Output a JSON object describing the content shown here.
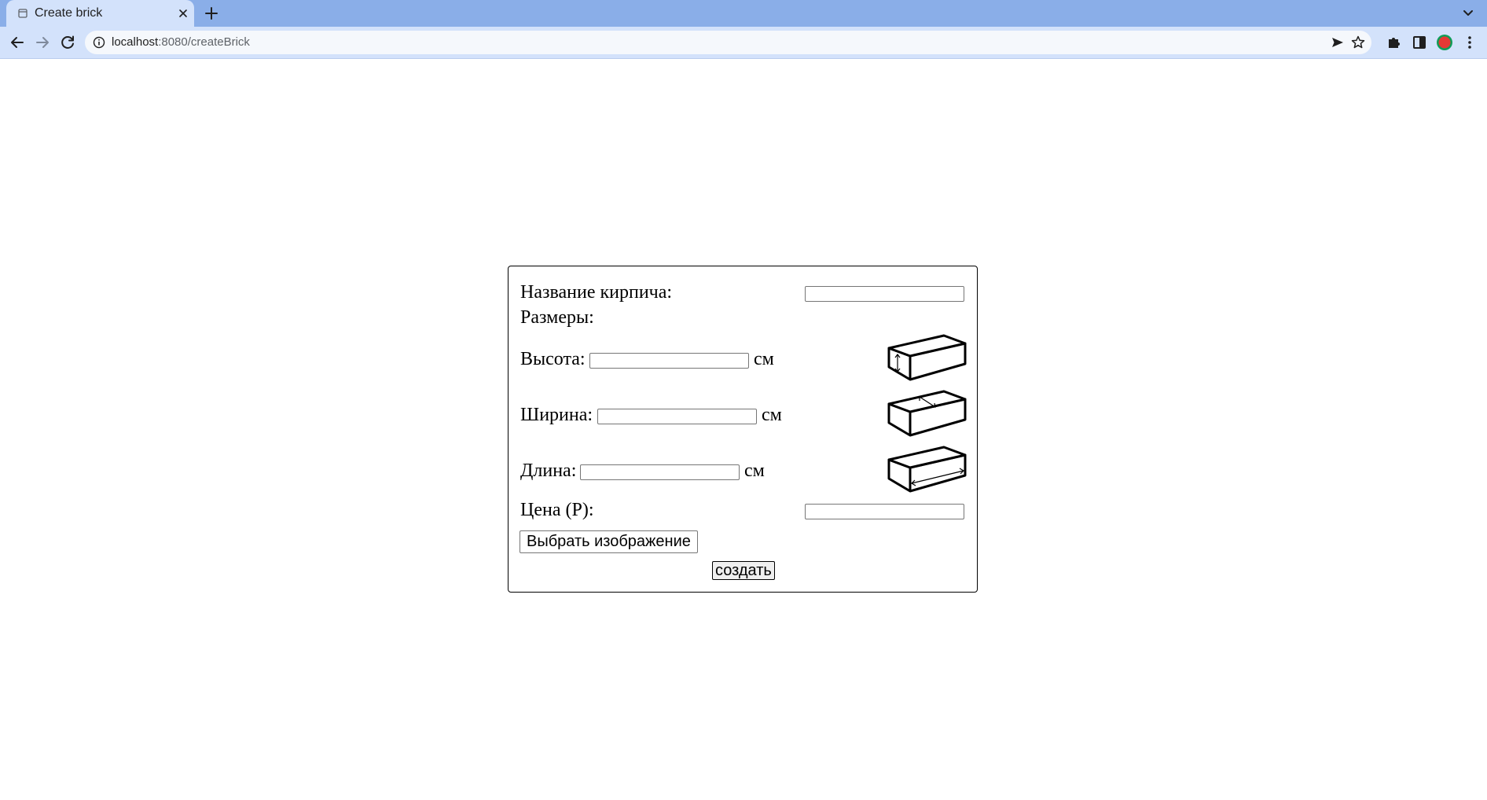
{
  "browser": {
    "tab_title": "Create brick",
    "url_host": "localhost",
    "url_path": ":8080/createBrick"
  },
  "form": {
    "name_label": "Название кирпича:",
    "name_value": "",
    "sizes_label": "Размеры:",
    "height_label": "Высота:",
    "height_value": "",
    "height_unit": "см",
    "width_label": "Ширина:",
    "width_value": "",
    "width_unit": "см",
    "length_label": "Длина:",
    "length_value": "",
    "length_unit": "см",
    "price_label": "Цена (Р):",
    "price_value": "",
    "choose_image_label": "Выбрать изображение",
    "submit_label": "создать"
  },
  "icons": {
    "tab_favicon": "page-icon",
    "tab_close": "close-icon",
    "new_tab": "plus-icon",
    "tab_menu": "chevron-down-icon",
    "back": "arrow-left-icon",
    "forward": "arrow-right-icon",
    "reload": "reload-icon",
    "site_info": "info-icon",
    "send": "send-icon",
    "bookmark": "star-icon",
    "extensions": "puzzle-icon",
    "side_panel": "side-panel-icon",
    "profile": "profile-avatar-icon",
    "menu": "kebab-menu-icon"
  },
  "colors": {
    "tabstrip": "#8aaee8",
    "toolbar": "#d3e2fb",
    "profile_ring": "#0f9d58",
    "profile_fill": "#e53935"
  }
}
